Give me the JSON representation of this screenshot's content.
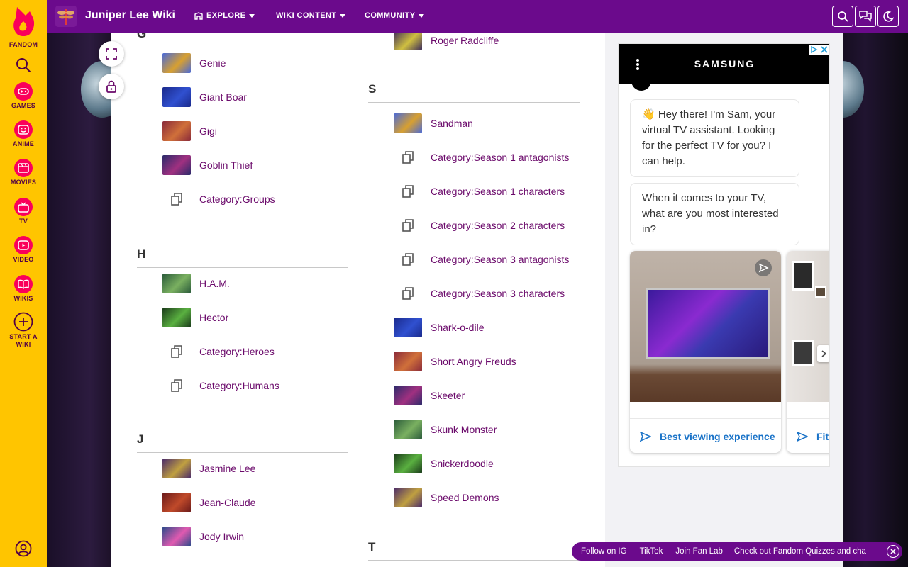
{
  "global_nav": {
    "fandom_label": "FANDOM",
    "items": [
      {
        "label": "GAMES",
        "icon": "games-icon"
      },
      {
        "label": "ANIME",
        "icon": "anime-icon"
      },
      {
        "label": "MOVIES",
        "icon": "movies-icon"
      },
      {
        "label": "TV",
        "icon": "tv-icon"
      },
      {
        "label": "VIDEO",
        "icon": "video-icon"
      },
      {
        "label": "WIKIS",
        "icon": "wikis-icon"
      }
    ],
    "start_wiki_line1": "START A",
    "start_wiki_line2": "WIKI"
  },
  "topbar": {
    "wiki_title": "Juniper Lee Wiki",
    "nav": [
      {
        "label": "EXPLORE"
      },
      {
        "label": "WIKI CONTENT"
      },
      {
        "label": "COMMUNITY"
      }
    ]
  },
  "colors": {
    "fandom_yellow": "#ffc500",
    "wiki_purple": "#6b0a8c",
    "link": "#6b0a6b"
  },
  "category_list": {
    "left_column": {
      "sections": [
        {
          "letter": "G",
          "entries": [
            {
              "label": "Genie",
              "type": "page"
            },
            {
              "label": "Giant Boar",
              "type": "page"
            },
            {
              "label": "Gigi",
              "type": "page"
            },
            {
              "label": "Goblin Thief",
              "type": "page"
            },
            {
              "label": "Category:Groups",
              "type": "category"
            }
          ]
        },
        {
          "letter": "H",
          "entries": [
            {
              "label": "H.A.M.",
              "type": "page"
            },
            {
              "label": "Hector",
              "type": "page"
            },
            {
              "label": "Category:Heroes",
              "type": "category"
            },
            {
              "label": "Category:Humans",
              "type": "category"
            }
          ]
        },
        {
          "letter": "J",
          "entries": [
            {
              "label": "Jasmine Lee",
              "type": "page"
            },
            {
              "label": "Jean-Claude",
              "type": "page"
            },
            {
              "label": "Jody Irwin",
              "type": "page"
            }
          ]
        }
      ]
    },
    "right_column": {
      "top_entry": {
        "label": "Roger Radcliffe",
        "type": "page"
      },
      "sections": [
        {
          "letter": "S",
          "entries": [
            {
              "label": "Sandman",
              "type": "page"
            },
            {
              "label": "Category:Season 1 antagonists",
              "type": "category"
            },
            {
              "label": "Category:Season 1 characters",
              "type": "category"
            },
            {
              "label": "Category:Season 2 characters",
              "type": "category"
            },
            {
              "label": "Category:Season 3 antagonists",
              "type": "category"
            },
            {
              "label": "Category:Season 3 characters",
              "type": "category"
            },
            {
              "label": "Shark-o-dile",
              "type": "page"
            },
            {
              "label": "Short Angry Freuds",
              "type": "page"
            },
            {
              "label": "Skeeter",
              "type": "page"
            },
            {
              "label": "Skunk Monster",
              "type": "page"
            },
            {
              "label": "Snickerdoodle",
              "type": "page"
            },
            {
              "label": "Speed Demons",
              "type": "page"
            }
          ]
        },
        {
          "letter": "T",
          "entries": []
        }
      ]
    }
  },
  "ad": {
    "brand": "SAMSUNG",
    "bubble1": "👋 Hey there! I'm Sam, your virtual TV assistant. Looking for the perfect TV for you? I can help.",
    "bubble2": "When it comes to your TV, what are you most interested in?",
    "card1_cta": "Best viewing experience",
    "card2_cta": "Fits"
  },
  "promo": {
    "items": [
      "Follow on IG",
      "TikTok",
      "Join Fan Lab",
      "Check out Fandom Quizzes and cha"
    ]
  }
}
